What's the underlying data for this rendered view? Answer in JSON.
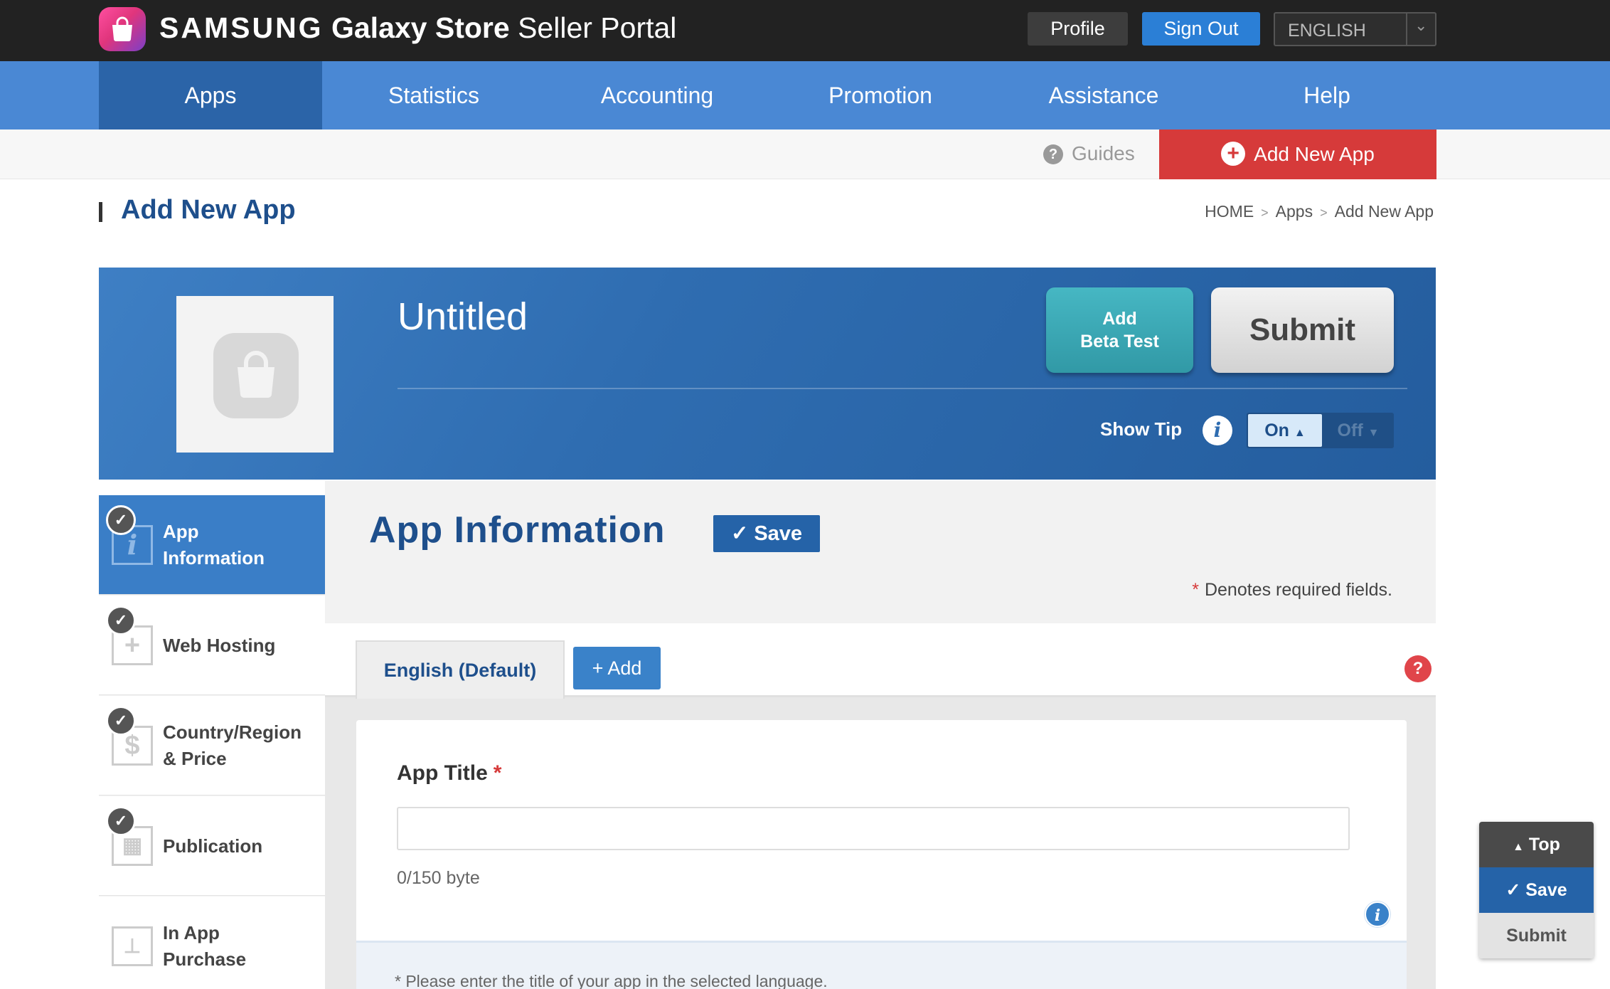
{
  "brand": {
    "samsung": "SAMSUNG",
    "galaxy_store": "Galaxy Store",
    "seller_portal": "Seller Portal"
  },
  "topbar": {
    "profile": "Profile",
    "sign_out": "Sign Out",
    "language": "ENGLISH"
  },
  "nav": {
    "items": [
      "Apps",
      "Statistics",
      "Accounting",
      "Promotion",
      "Assistance",
      "Help"
    ],
    "active": "Apps"
  },
  "subbar": {
    "guides": "Guides",
    "add_new_app": "Add New App"
  },
  "page": {
    "title": "Add New App",
    "breadcrumb": [
      "HOME",
      "Apps",
      "Add New App"
    ]
  },
  "banner": {
    "app_name": "Untitled",
    "add_beta_line1": "Add",
    "add_beta_line2": "Beta Test",
    "submit": "Submit",
    "show_tip": "Show Tip",
    "toggle_on": "On",
    "toggle_off": "Off"
  },
  "steps": [
    {
      "label1": "App",
      "label2": "Information",
      "active": true
    },
    {
      "label1": "Web Hosting",
      "label2": ""
    },
    {
      "label1": "Country/Region",
      "label2": "& Price"
    },
    {
      "label1": "Publication",
      "label2": ""
    },
    {
      "label1": "In App",
      "label2": "Purchase"
    }
  ],
  "section": {
    "title": "App Information",
    "save": "Save",
    "required_note": "Denotes required fields."
  },
  "tabs": {
    "english": "English (Default)",
    "add": "Add"
  },
  "form": {
    "app_title_label": "App Title",
    "app_title_value": "",
    "byte_count": "0/150 byte",
    "tip": "* Please enter the title of your app in the selected language."
  },
  "float": {
    "top": "Top",
    "save": "Save",
    "submit": "Submit"
  },
  "colors": {
    "topbar": "#222222",
    "nav": "#4a88d4",
    "nav_active": "#2b64a8",
    "accent_red": "#d63a3a",
    "banner": "#2f6db1",
    "beta": "#3fa9b6"
  }
}
